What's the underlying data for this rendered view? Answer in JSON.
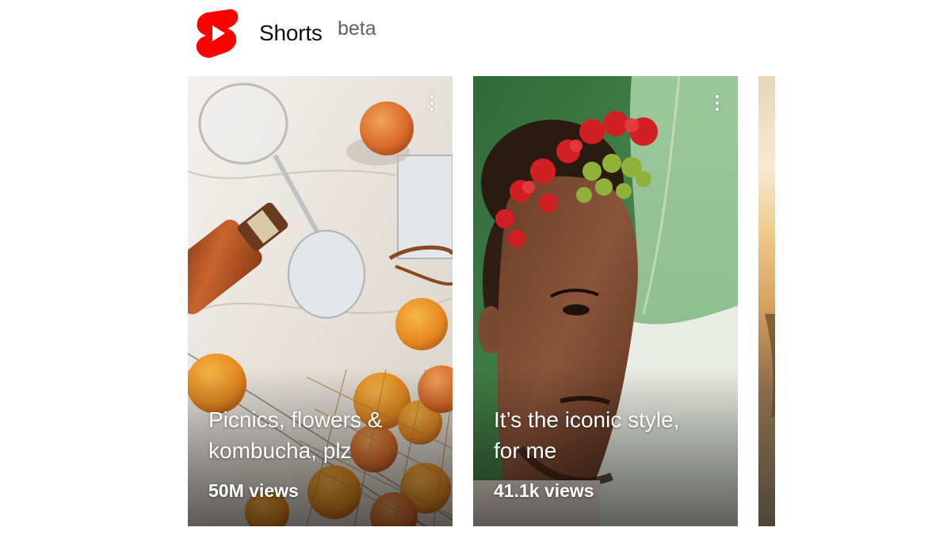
{
  "header": {
    "logo_icon": "youtube-shorts-logo-icon",
    "title": "Shorts",
    "badge": "beta",
    "brand_color": "#ff0000"
  },
  "shorts": [
    {
      "title_line_1": "Picnics, flowers &",
      "title_line_2": "kombucha, plz",
      "views": "50M views",
      "menu_icon": "more-vertical-icon",
      "thumbnail": "picnic-still-life-thumbnail"
    },
    {
      "title_line_1": "It’s the iconic style,",
      "title_line_2": "for me",
      "views": "41.1k views",
      "menu_icon": "more-vertical-icon",
      "thumbnail": "portrait-with-flowers-thumbnail"
    },
    {
      "thumbnail": "sunset-water-thumbnail"
    }
  ]
}
